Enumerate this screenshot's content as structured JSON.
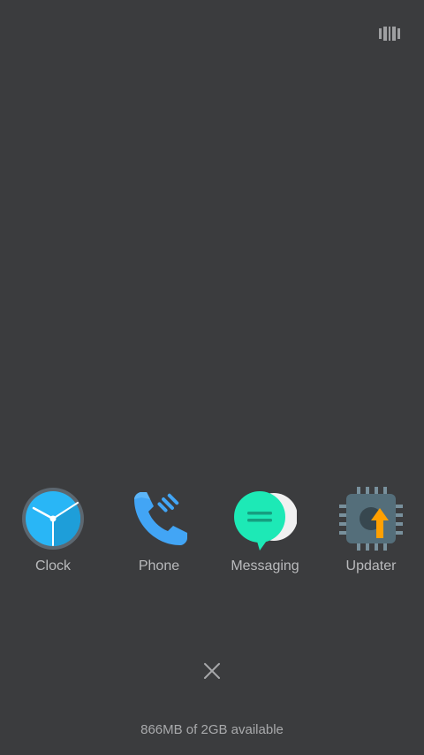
{
  "recents": {
    "layout_toggle_icon": "view-carousel-icon",
    "apps": [
      {
        "label": "Clock",
        "icon": "clock-icon"
      },
      {
        "label": "Phone",
        "icon": "phone-icon"
      },
      {
        "label": "Messaging",
        "icon": "messaging-icon"
      },
      {
        "label": "Updater",
        "icon": "updater-icon"
      }
    ],
    "close_all_icon": "close-icon",
    "memory_status": "866MB of 2GB available"
  },
  "colors": {
    "background": "#3b3c3e",
    "label_text": "#b9babc",
    "clock_face": "#29b6f6",
    "phone_blue": "#42a5f5",
    "messaging_teal": "#1de9b6",
    "updater_chip": "#546e7a",
    "updater_arrow": "#ffa000"
  }
}
